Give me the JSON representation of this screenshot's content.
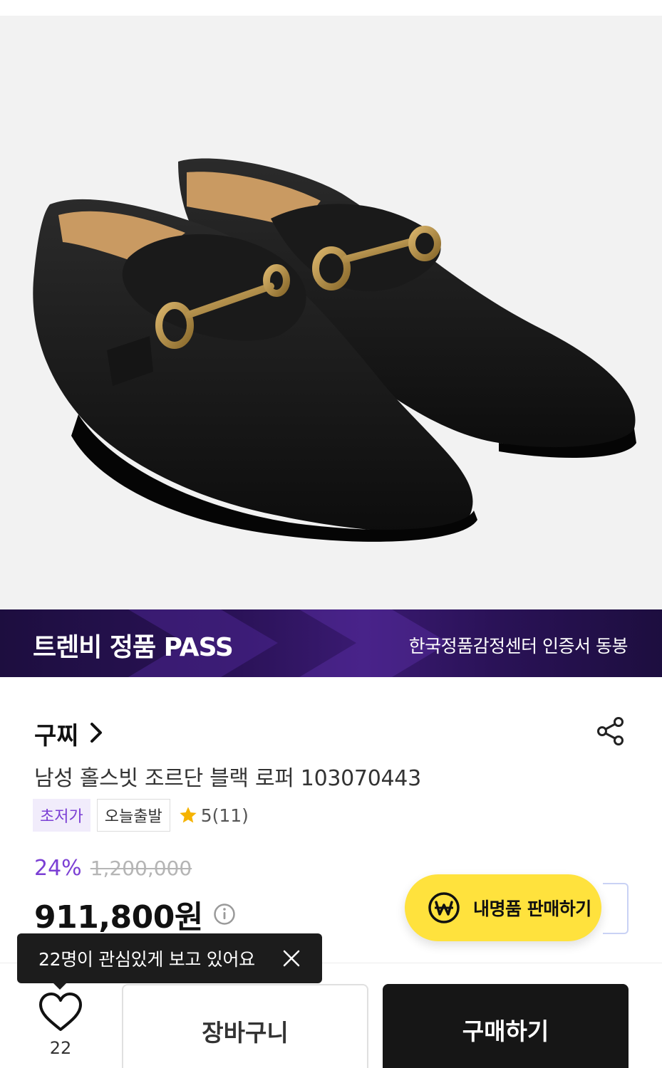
{
  "colors": {
    "accent_purple": "#7b3fd4",
    "banner_bg": "#2a1257",
    "sell_button_yellow": "#ffe23d",
    "buy_button_black": "#161616"
  },
  "product_image": {
    "icon": "loafer-pair-image"
  },
  "pass_banner": {
    "title": "트렌비 정품 PASS",
    "subtitle": "한국정품감정센터 인증서 동봉"
  },
  "brand": {
    "name": "구찌",
    "chevron_icon": "chevron-right-icon"
  },
  "share": {
    "icon": "share-icon"
  },
  "product": {
    "title": "남성 홀스빗 조르단 블랙 로퍼 103070443",
    "tags": [
      "초저가",
      "오늘출발"
    ],
    "rating_text": "5(11)",
    "discount_rate": "24%",
    "original_price": "1,200,000",
    "sale_price": "911,800원"
  },
  "sell_button": {
    "label": "내명품 판매하기",
    "icon": "won-circle-icon"
  },
  "tooltip": {
    "text": "22명이 관심있게 보고 있어요",
    "close_icon": "close-icon"
  },
  "bottom_bar": {
    "like_count": "22",
    "like_icon": "heart-icon",
    "cart_label": "장바구니",
    "buy_label": "구매하기"
  }
}
